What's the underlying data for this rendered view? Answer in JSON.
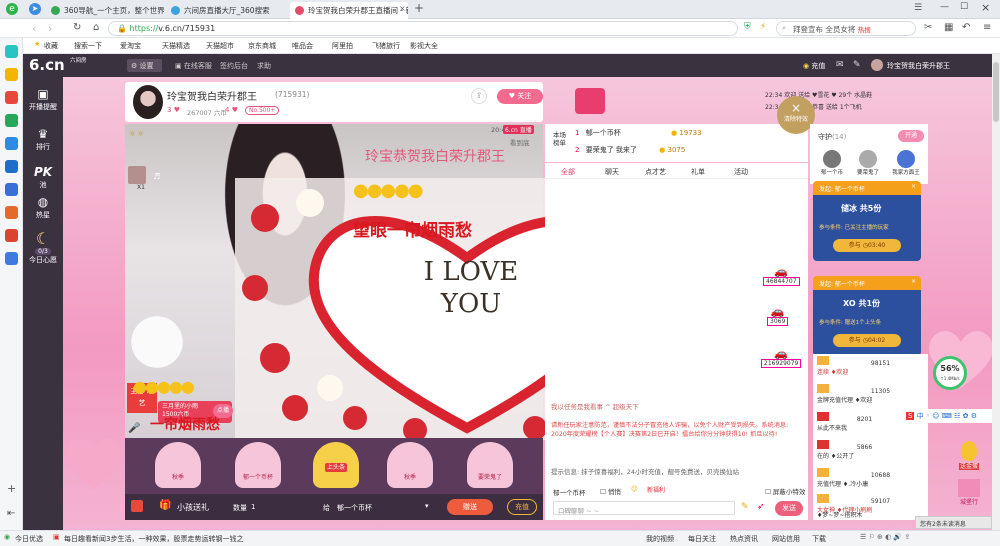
{
  "browser": {
    "tabs": [
      {
        "label": "360导航_一个主页，整个世界",
        "active": false
      },
      {
        "label": "六间房直播大厅_360搜索",
        "active": false
      },
      {
        "label": "玲宝贺我白荣升郡王直播间 - 新",
        "active": true
      }
    ],
    "url_protocol": "https://",
    "url": "v.6.cn/715931",
    "search_placeholder": "拜登宣布 全员女将",
    "search_badge": "热搜",
    "bookmarks": [
      "收藏",
      "搜索一下",
      "爱淘宝",
      "天猫精选",
      "天猫超市",
      "京东商城",
      "唯品会",
      "阿里拍",
      "飞猪旅行",
      "影视大全"
    ]
  },
  "site": {
    "logo": "6.cn",
    "logo_sub": "六间房",
    "settings": "设置",
    "online_service": "在线客服",
    "sign_in": "签约后台",
    "help": "求助",
    "recharge": "充值",
    "username": "玲宝贺我白荣升郡王"
  },
  "leftnav": [
    {
      "icon": "▣",
      "label": "开播提醒"
    },
    {
      "icon": "♛",
      "label": "排行"
    },
    {
      "icon": "PK",
      "label": "池"
    },
    {
      "icon": "◍",
      "label": "热星"
    },
    {
      "icon": "☾",
      "label": "今日心愿",
      "badge": "0/3"
    }
  ],
  "host": {
    "name": "玲宝贺我白荣升郡王",
    "room_id": "(715931)",
    "level": "3",
    "fans": "267007",
    "fans_unit": "六币",
    "rank": "4",
    "no_badge": "No.500+",
    "follow": "关注"
  },
  "video": {
    "time": "20:44",
    "live_logo": "6.cn",
    "live_tag": "直播",
    "watch_later": "看到底",
    "overlay_title": "玲宝恭贺我白荣升郡王",
    "banner_text": "望眼一帘烟雨愁",
    "love_text": "I LOVE YOU",
    "bottom_text": "一帘烟雨愁",
    "host_badge": "主打 才艺",
    "song_tag": "三月里的小雨",
    "song_price": "1500六币",
    "order": "点播",
    "viewer_count": "X1"
  },
  "gift_stand": [
    {
      "name": "秋季",
      "sub": "冬季"
    },
    {
      "name": "郁一个币杯",
      "sub": ""
    },
    {
      "name": "上头条",
      "sub": ""
    },
    {
      "name": "秋季",
      "sub": ""
    },
    {
      "name": "要荣鬼了",
      "sub": ""
    }
  ],
  "gift_bar": {
    "title": "小孩送礼",
    "qty_label": "数量",
    "qty": "1",
    "to_label": "给",
    "to": "郁一个币杯",
    "send": "赠送",
    "recharge": "充值"
  },
  "rank_panel": {
    "title": "本场榜单",
    "rows": [
      {
        "rank": "1",
        "name": "郁一个币杯",
        "score": "19733"
      },
      {
        "rank": "2",
        "name": "要荣鬼了 我来了",
        "score": "3075"
      }
    ]
  },
  "notice_bar": {
    "items": [
      "22:34 欢迎 送给 ♥雪花 ♥ 29个 水晶鞋",
      "22:34 恭喜 送给 恭喜 送给 1个飞机"
    ]
  },
  "close_effect": "清除特效",
  "chat": {
    "tabs": [
      "全部",
      "聊天",
      "点才艺",
      "礼单",
      "活动"
    ],
    "vehicles": [
      {
        "num": "46844707"
      },
      {
        "num": "3069"
      },
      {
        "num": "216929079"
      }
    ],
    "system_line": "我以任务是我看事 ^ 超级天下",
    "announcement": "请新任玩家注意防范，谨慎不法分子冒充他人诈骗，以免个人财产受到损失。系统消息: 2020年度荣耀榜【个人赛】决赛第2日已开启！擂台给你分分钟获得10! 抓旦以待!",
    "tip": "提示信息: 抹子惊喜福利，24小时充值，靓号免费送，贝壳换仙站",
    "input_to": "郁一个币杯",
    "whisper": "悄悄",
    "new_tag": "新福利",
    "block_effect": "屏蔽小特效",
    "input_placeholder": "口碑聊聊 ~ ~",
    "send": "发送"
  },
  "guard": {
    "title": "守护",
    "count": "(14)",
    "open": "开通",
    "members": [
      "郁一个币",
      "要荣鬼了",
      "我家方面王"
    ]
  },
  "red_packets": [
    {
      "from": "发起: 郁一个币杯",
      "title": "储冰 共5份",
      "cond": "参与条件: 已关注主播的玩家",
      "join": "参与",
      "timer": "03:40"
    },
    {
      "from": "发起: 郁一个币杯",
      "title": "XO 共1份",
      "cond": "参与条件: 赠送1个上头条",
      "join": "参与",
      "timer": "04:02"
    }
  ],
  "fans_list": [
    {
      "name": "连续 ♦欢迎",
      "score": "98151"
    },
    {
      "name": "金牌充值代理 ♦欢迎",
      "score": "11305"
    },
    {
      "name": "从此不来我",
      "score": "8201"
    },
    {
      "name": "在的 ♦公开了",
      "score": "5866"
    },
    {
      "name": "充值代理 ♦.冷小康",
      "score": "10688"
    },
    {
      "name": "大女神 ♦代理小刷刷",
      "score": "59107"
    },
    {
      "name": "♦梦~梦~搭积木",
      "score": ""
    }
  ],
  "right_float": {
    "percent": "56%",
    "speed": "↑1.4Mb/s",
    "gift_label": "送金蛋",
    "castle": "城堡行",
    "msg_box": "您有2条未读消息"
  },
  "statusbar": {
    "left": "今日优选",
    "news": "每日趣看新闻3步生活，一种效果，股票走势运转钢一钱之力",
    "items": [
      "我的视频",
      "每日关注",
      "热点资讯",
      "网站信用",
      "下载"
    ]
  }
}
